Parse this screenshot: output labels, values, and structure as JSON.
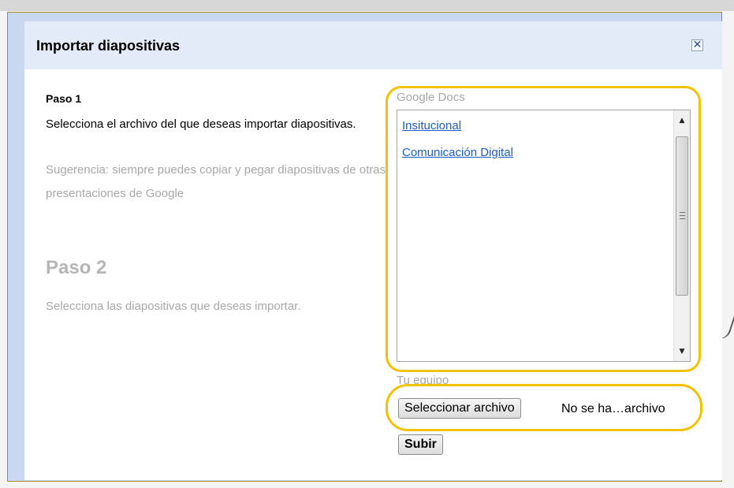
{
  "dialog": {
    "title": "Importar diapositivas",
    "close_icon": "close-icon"
  },
  "step1": {
    "label": "Paso 1",
    "description": "Selecciona el archivo del que deseas importar diapositivas.",
    "hint": "Sugerencia: siempre puedes copiar y pegar diapositivas de otras presentaciones de Google"
  },
  "step2": {
    "label": "Paso 2",
    "description": "Selecciona las diapositivas que deseas importar."
  },
  "google_docs": {
    "label": "Google Docs",
    "items": [
      {
        "label": "Insitucional"
      },
      {
        "label": "Comunicación Digital"
      }
    ]
  },
  "computer": {
    "label": "Tu equipo",
    "choose_file_label": "Seleccionar archivo",
    "file_status": "No se ha…archivo",
    "upload_label": "Subir"
  },
  "colors": {
    "highlight": "#f2c200",
    "link": "#1a5dc9",
    "header_bg": "#e3ebf8",
    "dialog_border": "#c9d7f1"
  }
}
